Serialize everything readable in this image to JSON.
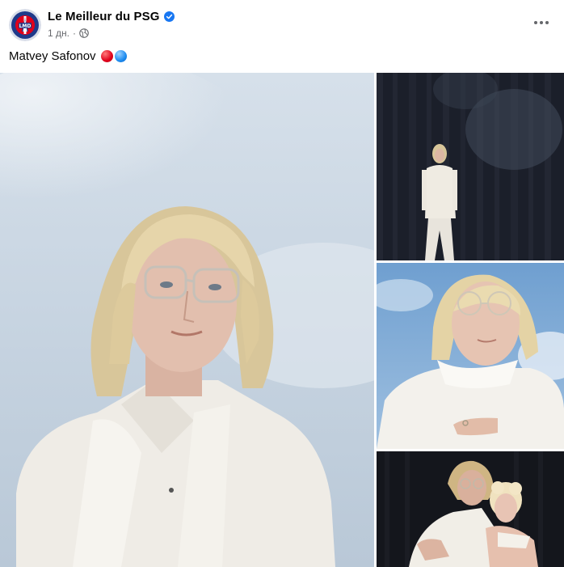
{
  "post": {
    "page_name": "Le Meilleur du PSG",
    "verified": true,
    "timestamp": "1 дн.",
    "separator": "·",
    "audience_icon": "globe-icon",
    "more_icon": "more-dots-icon",
    "caption_text": "Matvey Safonov",
    "caption_emojis": [
      "red-circle-emoji",
      "blue-circle-emoji"
    ]
  },
  "colors": {
    "psg_blue": "#1f3a8a",
    "psg_red": "#e0001b",
    "verified_blue": "#1877f2",
    "secondary_text": "#65676b"
  },
  "gallery": {
    "photos": [
      {
        "name": "photo-main",
        "subject": "portrait of blond man with glasses and white scarf against sky"
      },
      {
        "name": "photo-side-1",
        "subject": "man in white suit standing before dark curtain"
      },
      {
        "name": "photo-side-2",
        "subject": "man in white shirt and glasses against blue sky"
      },
      {
        "name": "photo-side-3",
        "subject": "couple embracing before dark curtain"
      }
    ]
  }
}
